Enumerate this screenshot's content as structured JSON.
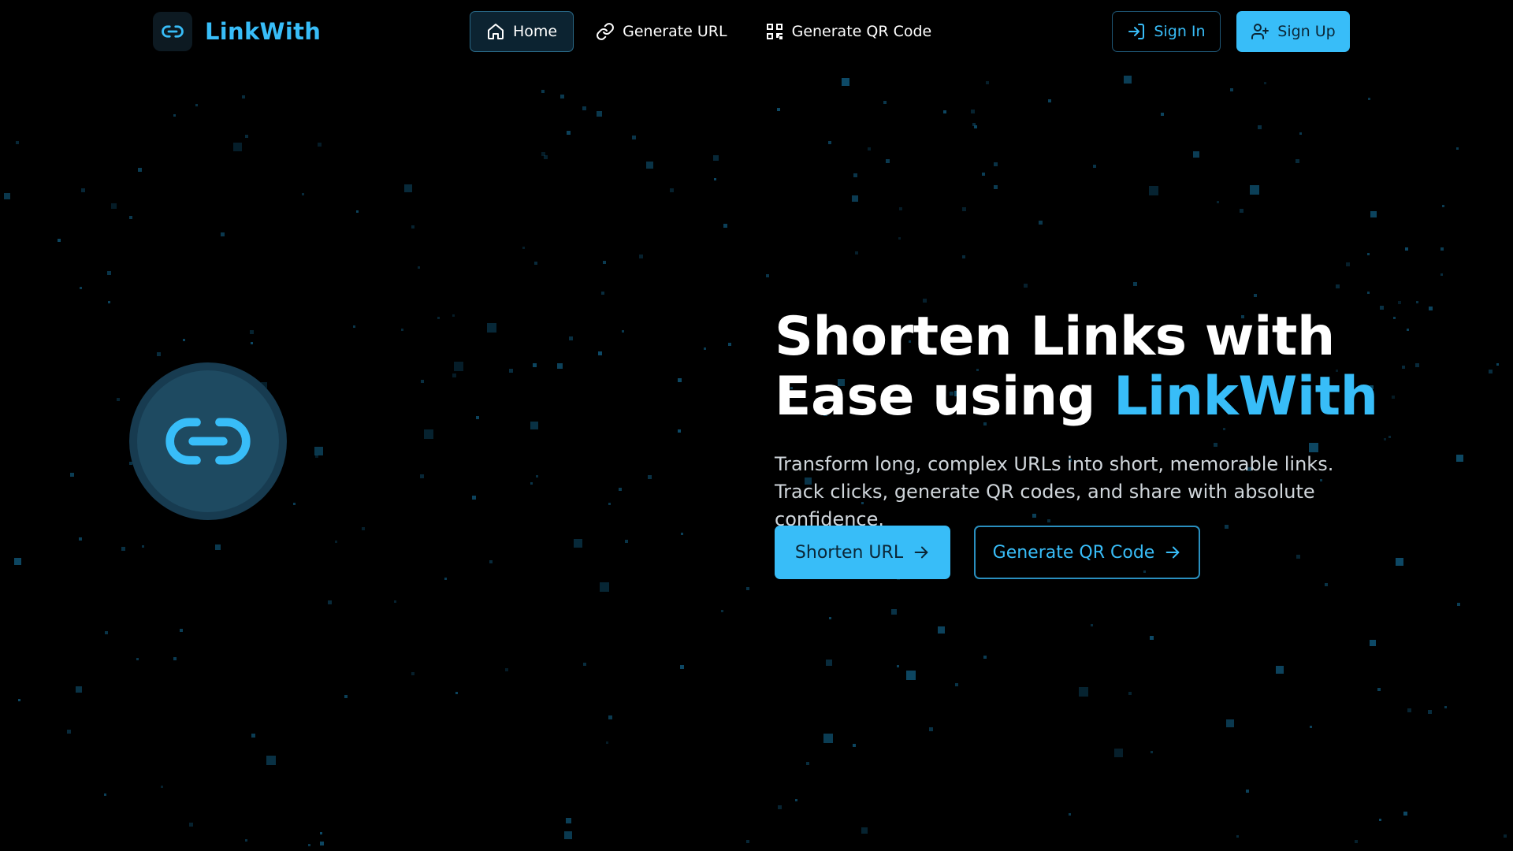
{
  "brand": {
    "name": "LinkWith",
    "icon": "link-icon"
  },
  "nav": {
    "items": [
      {
        "label": "Home",
        "icon": "home-icon",
        "active": true
      },
      {
        "label": "Generate URL",
        "icon": "link-icon",
        "active": false
      },
      {
        "label": "Generate QR Code",
        "icon": "qr-code-icon",
        "active": false
      }
    ]
  },
  "auth": {
    "sign_in_label": "Sign In",
    "sign_in_icon": "sign-in-icon",
    "sign_up_label": "Sign Up",
    "sign_up_icon": "user-plus-icon"
  },
  "hero": {
    "emblem_icon": "link-icon",
    "title_line1": "Shorten Links with",
    "title_line2_prefix": "Ease using ",
    "title_line2_accent": "LinkWith",
    "subtitle": "Transform long, complex URLs into short, memorable links. Track clicks, generate QR codes, and share with absolute confidence.",
    "primary_button": "Shorten URL",
    "secondary_button": "Generate QR Code",
    "button_icon": "arrow-right-icon"
  },
  "colors": {
    "background": "#000000",
    "accent": "#38bdf8",
    "particle": "#0e4d6b"
  }
}
